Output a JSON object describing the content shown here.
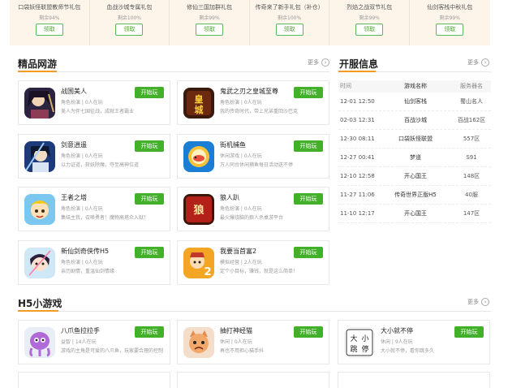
{
  "gifts": [
    {
      "name": "口袋妖怪联盟教师节礼包",
      "remain": "剩余94%",
      "btn": "领取"
    },
    {
      "name": "血战沙城专属礼包",
      "remain": "剩余100%",
      "btn": "领取"
    },
    {
      "name": "修仙三国加群礼包",
      "remain": "剩余99%",
      "btn": "领取"
    },
    {
      "name": "传奇来了新手礼包（补仓）",
      "remain": "剩余100%",
      "btn": "领取"
    },
    {
      "name": "烈焰之战双节礼包",
      "remain": "剩余99%",
      "btn": "领取"
    },
    {
      "name": "仙剑客栈中秋礼包",
      "remain": "剩余99%",
      "btn": "领取"
    }
  ],
  "sections": {
    "online": {
      "title": "精品网游",
      "more": "更多"
    },
    "server": {
      "title": "开服信息",
      "more": "更多"
    },
    "h5": {
      "title": "H5小游戏",
      "more": "更多"
    }
  },
  "online_games": [
    {
      "name": "战国美人",
      "meta": "角色扮演 | 0人在玩",
      "desc": "美人为伴七国征战，成就王者霸业",
      "btn": "开始玩"
    },
    {
      "name": "鬼武之刃之皇城至尊",
      "meta": "角色扮演 | 0人在玩",
      "desc": "我的传奇时代，带上兄弟重回沙巴克",
      "btn": "开始玩"
    },
    {
      "name": "剑意逍遥",
      "meta": "角色扮演 | 0人在玩",
      "desc": "以力证道，斩妖除魔，夺至高神位道",
      "btn": "开始玩"
    },
    {
      "name": "街机捕鱼",
      "meta": "休闲游戏 | 0人在玩",
      "desc": "万人同台休闲捕鱼每日活动送不停",
      "btn": "开始玩"
    },
    {
      "name": "王者之塔",
      "meta": "角色扮演 | 0人在玩",
      "desc": "集结主我，召唤勇者！魔物高塔众入狱！",
      "btn": "开始玩"
    },
    {
      "name": "狼人趴",
      "meta": "角色扮演 | 0人在玩",
      "desc": "最火爆烧脑的狼人杀桌游平台",
      "btn": "开始玩"
    },
    {
      "name": "新仙剑奇侠传H5",
      "meta": "角色扮演 | 0人在玩",
      "desc": "亲历剧情，重温仙剑情缘",
      "btn": "开始玩"
    },
    {
      "name": "我要当首富2",
      "meta": "模拟经营 | 2人在玩",
      "desc": "定个小目标，赚钱，就是这么简单！",
      "btn": "开始玩"
    }
  ],
  "servers": {
    "headers": [
      "时间",
      "游戏名称",
      "服务器名"
    ],
    "rows": [
      [
        "12-01 12:50",
        "仙剑客栈",
        "蜀山名人"
      ],
      [
        "02-03 12:31",
        "百战沙城",
        "百战162区"
      ],
      [
        "12-30 08:11",
        "口袋妖怪联盟",
        "557区"
      ],
      [
        "12-27 00:41",
        "梦道",
        "S91"
      ],
      [
        "12-10 12:58",
        "开心国王",
        "148区"
      ],
      [
        "11-27 11:06",
        "传奇世界正版H5",
        "40服"
      ],
      [
        "11-10 12:17",
        "开心国王",
        "147区"
      ]
    ]
  },
  "h5_games": [
    {
      "name": "八爪鱼拉拉手",
      "meta": "益智 | 14人在玩",
      "desc": "游戏的主角是可爱的八爪鱼，玩家要合理的控制",
      "btn": "开始玩"
    },
    {
      "name": "抽打神经猫",
      "meta": "休闲 | 0人在玩",
      "desc": "再也不用担心猫手抖",
      "btn": "开始玩"
    },
    {
      "name": "大小就不停",
      "meta": "休闲 | 9人在玩",
      "desc": "大小就不停，看你跳多久",
      "btn": "开始玩"
    }
  ]
}
